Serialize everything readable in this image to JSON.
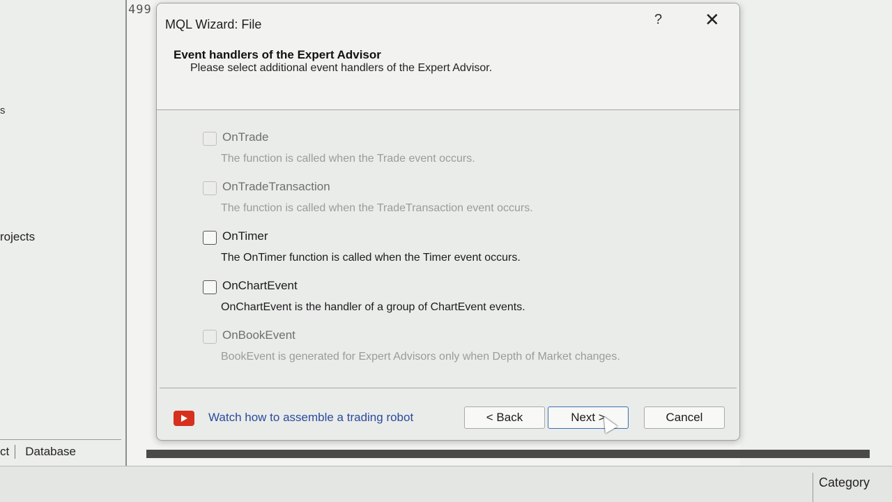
{
  "background": {
    "line_number": "499",
    "left_panel_text": "rojects",
    "left_panel_s": "s",
    "bottom_tabs": [
      "ct",
      "Database"
    ],
    "right_header": "Category"
  },
  "dialog": {
    "title": "MQL Wizard: File",
    "help_label": "?",
    "close_label": "✕",
    "section_title": "Event handlers of the Expert Advisor",
    "section_subtitle": "Please select additional event handlers of the Expert Advisor.",
    "handlers": [
      {
        "name": "OnTrade",
        "description": "The function is called when the Trade event occurs.",
        "enabled": false,
        "checked": false
      },
      {
        "name": "OnTradeTransaction",
        "description": "The function is called when the TradeTransaction event occurs.",
        "enabled": false,
        "checked": false
      },
      {
        "name": "OnTimer",
        "description": "The OnTimer function is called when the Timer event occurs.",
        "enabled": true,
        "checked": false
      },
      {
        "name": "OnChartEvent",
        "description": "OnChartEvent is the handler of a group of ChartEvent events.",
        "enabled": true,
        "checked": false
      },
      {
        "name": "OnBookEvent",
        "description": "BookEvent is generated for Expert Advisors only when Depth of Market changes.",
        "enabled": false,
        "checked": false
      }
    ],
    "footer": {
      "video_link": "Watch how to assemble a trading robot",
      "back_label": "< Back",
      "next_label": "Next >",
      "cancel_label": "Cancel"
    },
    "colors": {
      "link": "#2a4a9c",
      "youtube": "#d6301e",
      "default_button_border": "#3b6fb4"
    }
  }
}
